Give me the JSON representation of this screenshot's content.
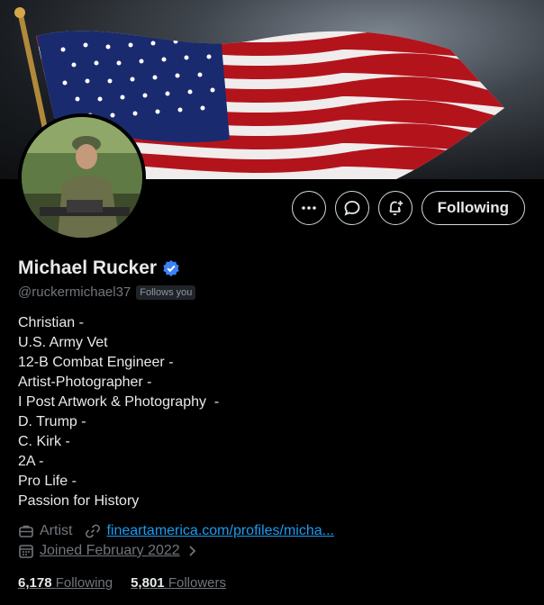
{
  "profile": {
    "name": "Michael Rucker",
    "handle": "@ruckermichael37",
    "follows_you": "Follows you",
    "verified_color": "#3b82f6"
  },
  "actions": {
    "more_icon": "ellipsis-icon",
    "message_icon": "chat-bubble-icon",
    "notify_icon": "bell-plus-icon",
    "following_label": "Following"
  },
  "bio": [
    "Christian -",
    "U.S. Army Vet",
    "12-B Combat Engineer -",
    "Artist-Photographer -",
    "I Post Artwork & Photography  -",
    "D. Trump -",
    "C. Kirk -",
    "2A -",
    "Pro Life -",
    "Passion for History"
  ],
  "meta": {
    "profession": "Artist",
    "website": "fineartamerica.com/profiles/micha...",
    "joined": "Joined February 2022"
  },
  "stats": {
    "following_count": "6,178",
    "following_label": "Following",
    "followers_count": "5,801",
    "followers_label": "Followers"
  },
  "colors": {
    "background": "#000000",
    "text": "#e7e9ea",
    "secondary": "#71767b",
    "link": "#1d9bf0"
  }
}
